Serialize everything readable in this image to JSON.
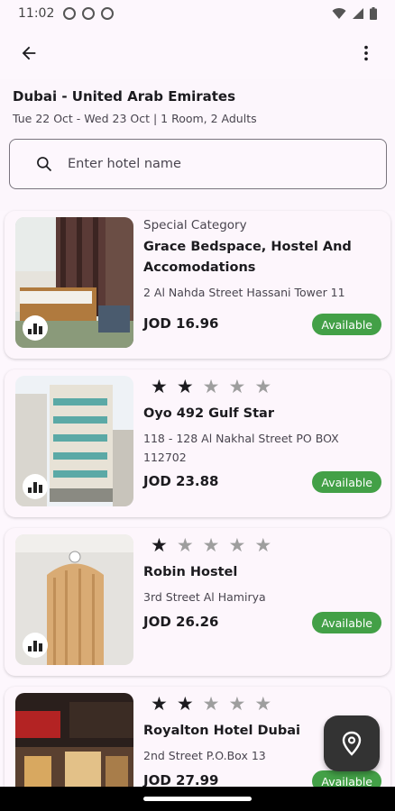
{
  "status_bar": {
    "time": "11:02"
  },
  "app_bar": {
    "back_icon": "arrow-left-icon",
    "menu_icon": "more-vert-icon"
  },
  "header": {
    "destination": "Dubai - United Arab Emirates",
    "dates": "Tue 22 Oct - Wed 23 Oct | 1 Room, 2 Adults",
    "search": {
      "placeholder": "Enter hotel name",
      "value": ""
    }
  },
  "colors": {
    "available_badge": "#43a047",
    "fab": "#333333"
  },
  "hotels": [
    {
      "category": "Special Category",
      "name": "Grace Bedspace, Hostel And Accomodations",
      "address": "2 Al Nahda Street Hassani Tower 11",
      "price": "JOD 16.96",
      "status": "Available"
    },
    {
      "stars": 2,
      "name": "Oyo 492 Gulf Star",
      "address": "118 - 128 Al Nakhal Street PO BOX 112702",
      "price": "JOD 23.88",
      "status": "Available"
    },
    {
      "stars": 1,
      "name": "Robin Hostel",
      "address": "3rd Street Al Hamirya",
      "price": "JOD 26.26",
      "status": "Available"
    },
    {
      "stars": 2,
      "name": "Royalton Hotel Dubai",
      "address": "2nd Street P.O.Box 13",
      "price": "JOD 27.99",
      "status": "Available"
    }
  ],
  "fab": {
    "icon": "map-pin-icon"
  }
}
